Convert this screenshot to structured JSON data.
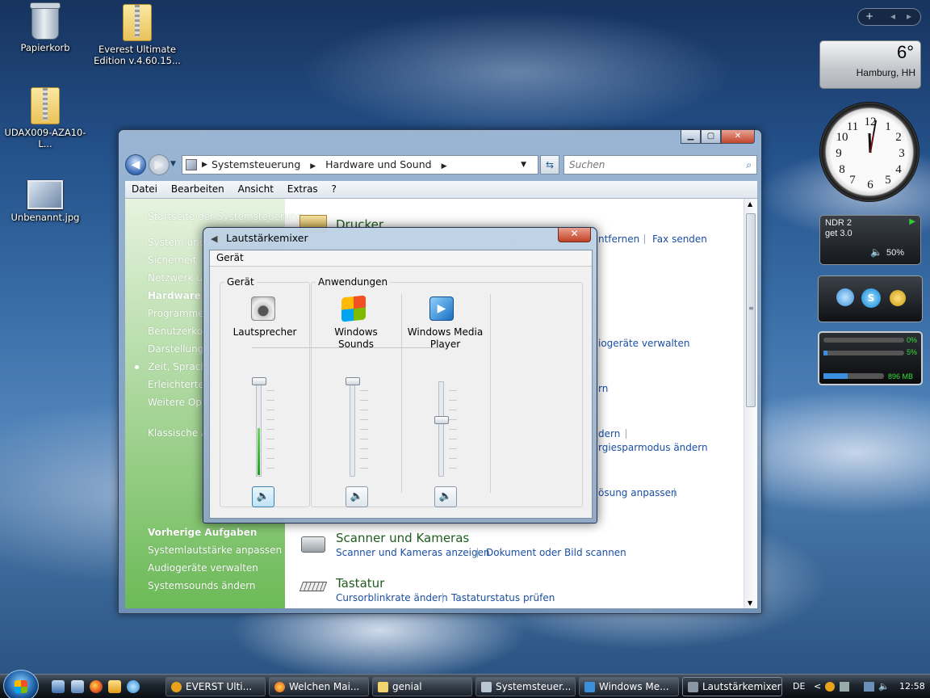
{
  "desktop": {
    "icons": [
      {
        "label": "Papierkorb"
      },
      {
        "label": "Everest Ultimate Edition v.4.60.15..."
      },
      {
        "label": "UDAX009-AZA10-L..."
      },
      {
        "label": "Unbenannt.jpg"
      }
    ]
  },
  "gadgets": {
    "sidebar_controls": {
      "add": "+",
      "prev": "◂",
      "next": "▸"
    },
    "weather": {
      "temperature": "6°",
      "city": "Hamburg, HH"
    },
    "clock": {
      "numerals": [
        "12",
        "1",
        "2",
        "3",
        "4",
        "5",
        "6",
        "7",
        "8",
        "9",
        "10",
        "11"
      ]
    },
    "radio": {
      "station": "NDR 2",
      "text": "get 3.0",
      "volume": "50%"
    },
    "meter": {
      "cpu": "0%",
      "ram": "5%",
      "mem": "896 MB"
    }
  },
  "control_panel": {
    "breadcrumb": [
      "Systemsteuerung",
      "Hardware und Sound"
    ],
    "search_placeholder": "Suchen",
    "menu": [
      "Datei",
      "Bearbeiten",
      "Ansicht",
      "Extras",
      "?"
    ],
    "left_nav": {
      "home": "Startseite der Systemsteuerung",
      "items": [
        "System und W",
        "Sicherheit",
        "Netzwerk und",
        "Hardware un",
        "Programme",
        "Benutzerkont",
        "Darstellung u",
        "Zeit, Sprache",
        "Erleichterte B",
        "Weitere Optio"
      ],
      "classic": "Klassische An",
      "recent_title": "Vorherige Aufgaben",
      "recent": [
        "Systemlautstärke anpassen",
        "Audiogeräte verwalten",
        "Systemsounds ändern"
      ]
    },
    "content": {
      "printer_title": "Drucker",
      "printer_links": [
        "ntfernen",
        "Fax senden"
      ],
      "audio_link": "iogeräte verwalten",
      "partial_rn": "rn",
      "partial_dern": "dern",
      "energy_link": "rgiesparmodus ändern",
      "display_link": "ösung anpassen",
      "scanner_title": "Scanner und Kameras",
      "scanner_links": [
        "Scanner und Kameras anzeigen",
        "Dokument oder Bild scannen"
      ],
      "keyboard_title": "Tastatur",
      "keyboard_links": [
        "Cursorblinkrate ändern",
        "Tastaturstatus prüfen"
      ]
    }
  },
  "mixer": {
    "title": "Lautstärkemixer",
    "menu": "Gerät",
    "device_group": "Gerät",
    "apps_group": "Anwendungen",
    "channels": [
      {
        "name": "Lautsprecher",
        "level": 1.0,
        "peak": 0.5
      },
      {
        "name": "Windows Sounds",
        "level": 1.0,
        "peak": 0
      },
      {
        "name": "Windows Media Player",
        "level": 0.6,
        "peak": 0
      }
    ]
  },
  "taskbar": {
    "buttons": [
      {
        "label": "EVERST Ulti..."
      },
      {
        "label": "Welchen Mai..."
      },
      {
        "label": "genial"
      },
      {
        "label": "Systemsteuer..."
      },
      {
        "label": "Windows Me..."
      },
      {
        "label": "Lautstärkemixer"
      }
    ],
    "language": "DE",
    "time": "12:58"
  }
}
